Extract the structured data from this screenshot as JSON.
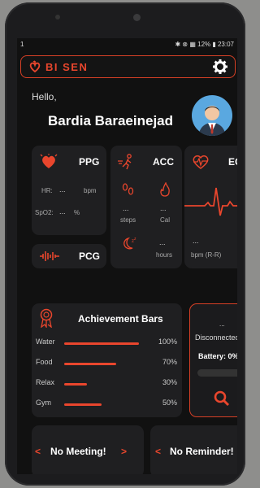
{
  "status": {
    "left": "1",
    "right": "✱ ⊗ ▦ 12% ▮ 23:07"
  },
  "app": {
    "brand": "BI SEN",
    "brand_full": "BIOSEN"
  },
  "greeting": {
    "hello": "Hello,",
    "name": "Bardia Baraeinejad"
  },
  "ppg": {
    "title": "PPG",
    "hr_label": "HR:",
    "hr_value": "...",
    "hr_unit": "bpm",
    "spo2_label": "SpO2:",
    "spo2_value": "...",
    "spo2_unit": "%"
  },
  "acc": {
    "title": "ACC",
    "steps_value": "...",
    "steps_label": "steps",
    "cal_value": "...",
    "cal_label": "Cal",
    "hours_value": "...",
    "hours_label": "hours"
  },
  "ecg": {
    "title": "ECG",
    "value": "...",
    "unit": "bpm (R-R)"
  },
  "pcg": {
    "title": "PCG"
  },
  "achievements": {
    "title": "Achievement Bars",
    "items": [
      {
        "label": "Water",
        "percent": 100,
        "display": "100%"
      },
      {
        "label": "Food",
        "percent": 70,
        "display": "70%"
      },
      {
        "label": "Relax",
        "percent": 30,
        "display": "30%"
      },
      {
        "label": "Gym",
        "percent": 50,
        "display": "50%"
      }
    ]
  },
  "device": {
    "dots": "...",
    "state": "Disconnected",
    "battery": "Battery: 0%"
  },
  "meeting": {
    "text": "No Meeting!",
    "prev": "<",
    "next": ">"
  },
  "reminder": {
    "text": "No Reminder!",
    "prev": "<",
    "next": ">"
  },
  "colors": {
    "accent": "#e9462d",
    "card": "#1f1f21",
    "background": "#111111"
  },
  "icons": [
    "heart-icon",
    "walking-icon",
    "ecg-heart-icon",
    "soundwave-icon",
    "ribbon-icon",
    "search-icon",
    "gear-icon"
  ]
}
